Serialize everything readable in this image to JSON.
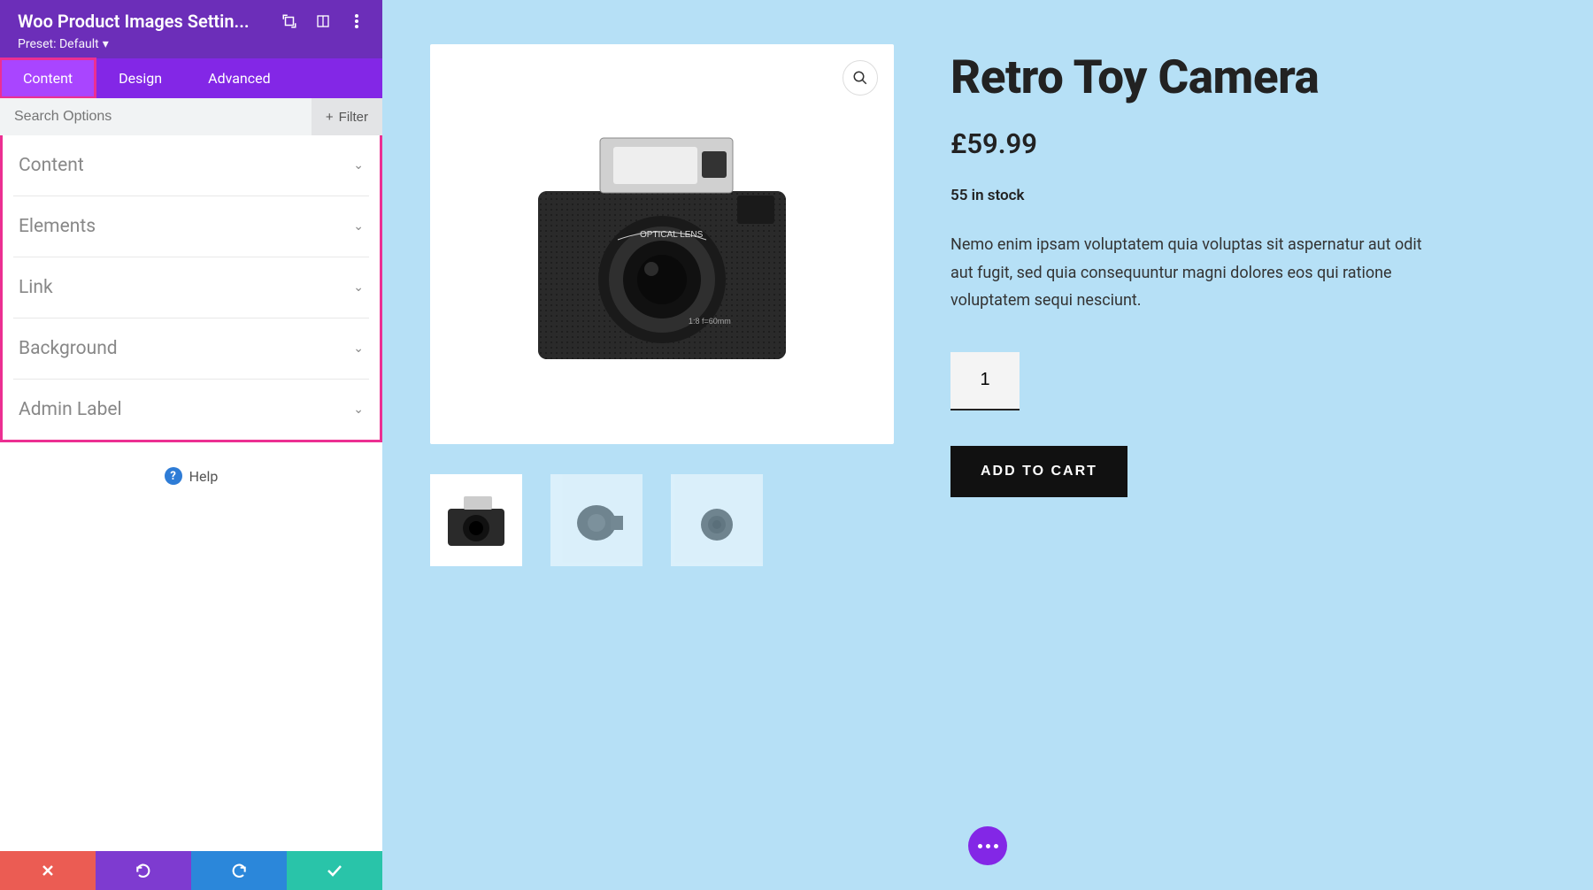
{
  "header": {
    "title": "Woo Product Images Settin...",
    "preset_label": "Preset: Default"
  },
  "tabs": [
    "Content",
    "Design",
    "Advanced"
  ],
  "active_tab": 0,
  "search": {
    "placeholder": "Search Options"
  },
  "filter_label": "Filter",
  "accordion": [
    "Content",
    "Elements",
    "Link",
    "Background",
    "Admin Label"
  ],
  "help_label": "Help",
  "product": {
    "title": "Retro Toy Camera",
    "price": "£59.99",
    "stock": "55 in stock",
    "description": "Nemo enim ipsam voluptatem quia voluptas sit aspernatur aut odit aut fugit, sed quia consequuntur magni dolores eos qui ratione voluptatem sequi nesciunt.",
    "quantity": "1",
    "add_to_cart": "ADD TO CART"
  }
}
